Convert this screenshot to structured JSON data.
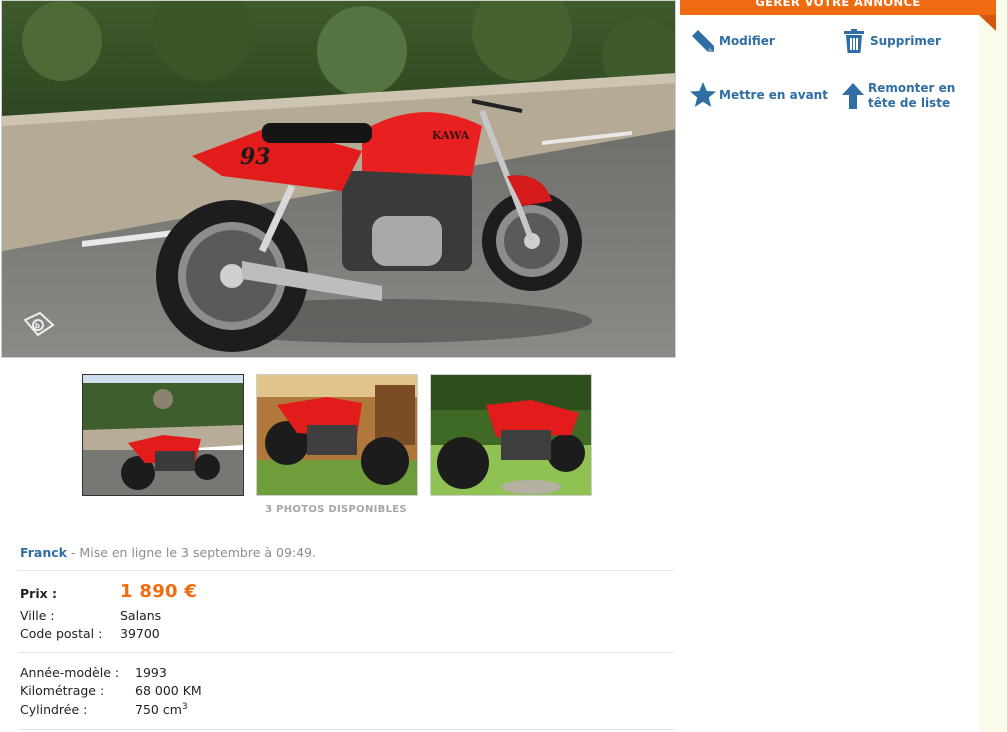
{
  "manage": {
    "header": "GÉRER VOTRE ANNONCE",
    "actions": [
      {
        "label": "Modifier",
        "icon": "pencil-icon"
      },
      {
        "label": "Supprimer",
        "icon": "trash-icon"
      },
      {
        "label": "Mettre en avant",
        "icon": "star-icon"
      },
      {
        "label": "Remonter en tête de liste",
        "icon": "arrow-up-icon"
      }
    ]
  },
  "photos": {
    "count_label": "3 PHOTOS DISPONIBLES",
    "badge_icon": "camera-logo-icon"
  },
  "listing": {
    "author": "Franck",
    "posted": "- Mise en ligne le 3 septembre à 09:49.",
    "price_label": "Prix :",
    "price": "1 890 €",
    "city_label": "Ville :",
    "city": "Salans",
    "postcode_label": "Code postal :",
    "postcode": "39700",
    "year_label": "Année-modèle :",
    "year": "1993",
    "mileage_label": "Kilométrage :",
    "mileage": "68 000 KM",
    "displacement_label": "Cylindrée :",
    "displacement": "750 cm",
    "displacement_sup": "3"
  },
  "colors": {
    "accent": "#ef6b12",
    "link": "#2f6ea5",
    "price": "#f36b10"
  }
}
